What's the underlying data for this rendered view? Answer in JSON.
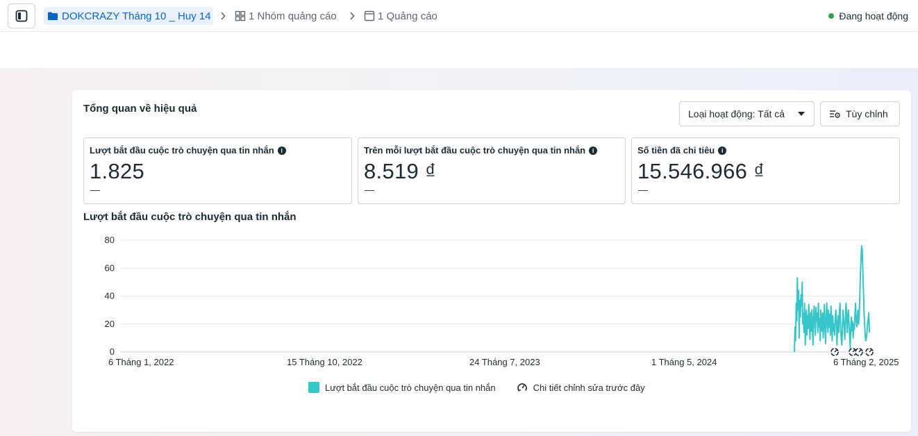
{
  "topbar": {
    "campaign": "DOKCRAZY Tháng 10 _ Huy 14",
    "adset": "1 Nhóm quảng cáo",
    "ad": "1 Quảng cáo",
    "status": "Đang hoạt động"
  },
  "overview": {
    "title": "Tổng quan về hiệu quả",
    "filter_label": "Loại hoạt động: Tất cả",
    "customize_label": "Tùy chỉnh"
  },
  "metrics": [
    {
      "label": "Lượt bắt đầu cuộc trò chuyện qua tin nhắn",
      "value": "1.825",
      "delta": "—"
    },
    {
      "label": "Trên mỗi lượt bắt đầu cuộc trò chuyện qua tin nhắn",
      "value": "8.519 ₫",
      "delta": "—"
    },
    {
      "label": "Số tiền đã chi tiêu",
      "value": "15.546.966 ₫",
      "delta": "—"
    }
  ],
  "chart_data": {
    "type": "line",
    "title": "Lượt bắt đầu cuộc trò chuyện qua tin nhắn",
    "x_tick_labels": [
      "6 Tháng 1, 2022",
      "15 Tháng 10, 2022",
      "24 Tháng 7, 2023",
      "1 Tháng 5, 2024",
      "6 Tháng 2, 2025"
    ],
    "y_ticks": [
      0,
      20,
      40,
      60,
      80
    ],
    "ylim": [
      0,
      80
    ],
    "grid": true,
    "legend_position": "bottom",
    "series": [
      {
        "name": "Lượt bắt đầu cuộc trò chuyện qua tin nhắn",
        "color": "#36c5c8",
        "x_fraction": [
          0.9,
          0.9008,
          0.9016,
          0.9024,
          0.9032,
          0.904,
          0.9048,
          0.9056,
          0.9064,
          0.9072,
          0.908,
          0.9088,
          0.9096,
          0.9104,
          0.9112,
          0.912,
          0.9128,
          0.9136,
          0.9144,
          0.9152,
          0.916,
          0.9168,
          0.9176,
          0.9184,
          0.9192,
          0.92,
          0.9208,
          0.9216,
          0.9224,
          0.9232,
          0.924,
          0.9248,
          0.9256,
          0.9264,
          0.9272,
          0.928,
          0.9288,
          0.9296,
          0.9304,
          0.9312,
          0.932,
          0.9328,
          0.9336,
          0.9344,
          0.9352,
          0.936,
          0.9368,
          0.9376,
          0.9384,
          0.9392,
          0.94,
          0.9408,
          0.9416,
          0.9424,
          0.9432,
          0.944,
          0.9448,
          0.9456,
          0.9464,
          0.9472,
          0.948,
          0.9488,
          0.9496,
          0.9504,
          0.9512,
          0.952,
          0.9528,
          0.9536,
          0.9544,
          0.9552,
          0.956,
          0.9568,
          0.9576,
          0.9584,
          0.9592,
          0.96,
          0.9608,
          0.9616,
          0.9624,
          0.9632,
          0.964,
          0.9648,
          0.9656,
          0.9664,
          0.9672,
          0.968,
          0.9688,
          0.9696,
          0.9704,
          0.9712,
          0.972,
          0.9728,
          0.9736,
          0.9744,
          0.9752,
          0.976,
          0.9768,
          0.9776,
          0.9784,
          0.9792,
          0.98,
          0.9808,
          0.9816,
          0.9824,
          0.9832,
          0.984,
          0.9848,
          0.9856,
          0.9864,
          0.9872,
          0.988,
          0.9888,
          0.9896,
          0.9904,
          0.9912,
          0.992,
          0.9928,
          0.9936,
          0.9944,
          0.9952,
          0.996,
          0.9968,
          0.9976,
          0.9984,
          0.9992,
          1.0
        ],
        "values": [
          0,
          18,
          8,
          35,
          22,
          53,
          30,
          44,
          10,
          37,
          25,
          41,
          33,
          50,
          20,
          28,
          14,
          35,
          5,
          22,
          30,
          12,
          26,
          17,
          34,
          20,
          9,
          28,
          15,
          30,
          18,
          5,
          25,
          33,
          20,
          12,
          32,
          22,
          28,
          14,
          35,
          18,
          24,
          8,
          30,
          20,
          15,
          28,
          10,
          22,
          34,
          16,
          6,
          25,
          35,
          20,
          14,
          30,
          18,
          27,
          12,
          33,
          22,
          8,
          26,
          15,
          20,
          12,
          24,
          30,
          22,
          5,
          18,
          26,
          14,
          28,
          35,
          20,
          10,
          5,
          15,
          30,
          25,
          18,
          9,
          22,
          35,
          28,
          14,
          24,
          30,
          20,
          12,
          3,
          18,
          25,
          15,
          22,
          10,
          20,
          16,
          28,
          35,
          22,
          18,
          25,
          30,
          20,
          26,
          40,
          55,
          66,
          76,
          74,
          60,
          45,
          30,
          20,
          12,
          8,
          10,
          14,
          20,
          24,
          28,
          14
        ]
      }
    ],
    "legend": [
      "Lượt bắt đầu cuộc trò chuyện qua tin nhắn",
      "Chi tiết chỉnh sửa trước đây"
    ]
  }
}
